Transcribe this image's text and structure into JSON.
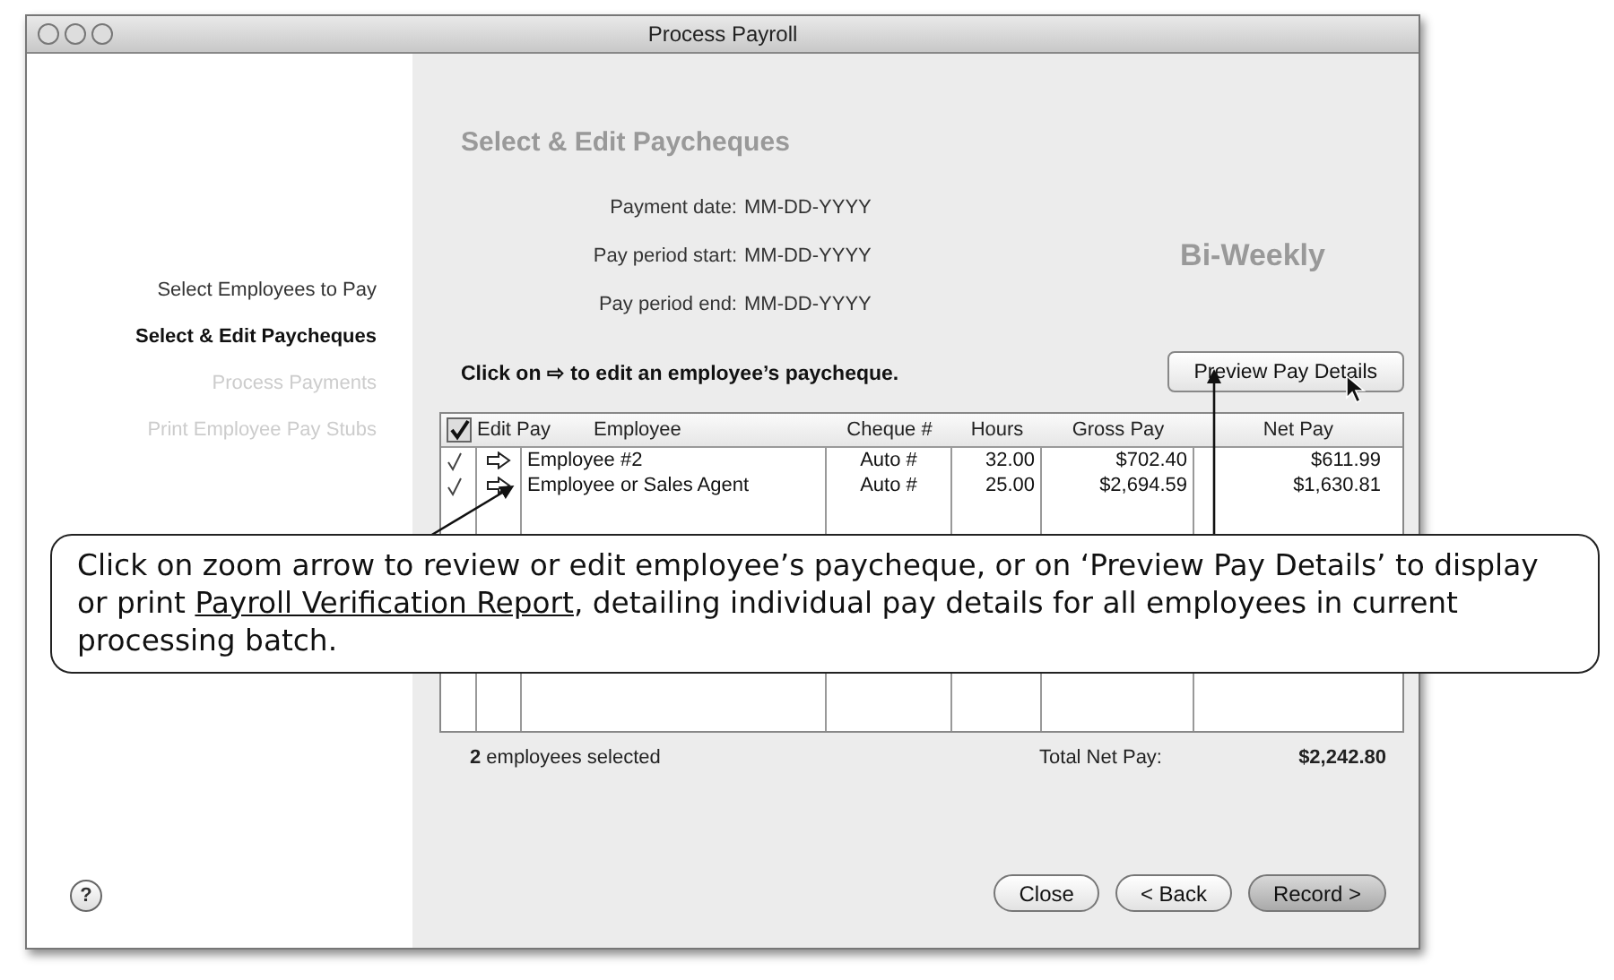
{
  "window": {
    "title": "Process Payroll"
  },
  "steps": [
    {
      "label": "Select Employees to Pay",
      "selected": false,
      "disabled": false
    },
    {
      "label": "Select & Edit Paycheques",
      "selected": true,
      "disabled": false
    },
    {
      "label": "Process Payments",
      "selected": false,
      "disabled": true
    },
    {
      "label": "Print Employee Pay Stubs",
      "selected": false,
      "disabled": true
    }
  ],
  "help": "?",
  "heading": "Select & Edit Paycheques",
  "dates": [
    {
      "label": "Payment date:",
      "value": "MM-DD-YYYY"
    },
    {
      "label": "Pay period start:",
      "value": "MM-DD-YYYY"
    },
    {
      "label": "Pay period end:",
      "value": "MM-DD-YYYY"
    }
  ],
  "frequency": "Bi-Weekly",
  "instruction": "Click on ⇨ to edit an employee’s paycheque.",
  "preview_button": "Preview Pay Details",
  "table": {
    "select_all": {
      "checked": true
    },
    "columns": [
      "Edit Pay",
      "Employee",
      "Cheque #",
      "Hours",
      "Gross Pay",
      "Net Pay"
    ],
    "rows": [
      {
        "checked": true,
        "employee": "Employee #2",
        "cheque": "Auto #",
        "hours": "32.00",
        "gross_pay": "$702.40",
        "net_pay": "$611.99"
      },
      {
        "checked": true,
        "employee": "Employee or Sales Agent",
        "cheque": "Auto #",
        "hours": "25.00",
        "gross_pay": "$2,694.59",
        "net_pay": "$1,630.81"
      }
    ]
  },
  "summary": {
    "selected": "**2** employees selected",
    "total_label": "Total Net Pay:",
    "total": "$2,242.80"
  },
  "buttons": [
    {
      "label": "Close",
      "default": false
    },
    {
      "label": "< Back",
      "default": false
    },
    {
      "label": "Record >",
      "default": true
    }
  ],
  "callout": {
    "before": "Click on zoom arrow to review or edit employee’s paycheque, or on ‘Preview Pay Details’ to display or print ",
    "link": "Payroll Verification Report",
    "after": ", detailing individual pay details for all employees in current processing batch."
  }
}
